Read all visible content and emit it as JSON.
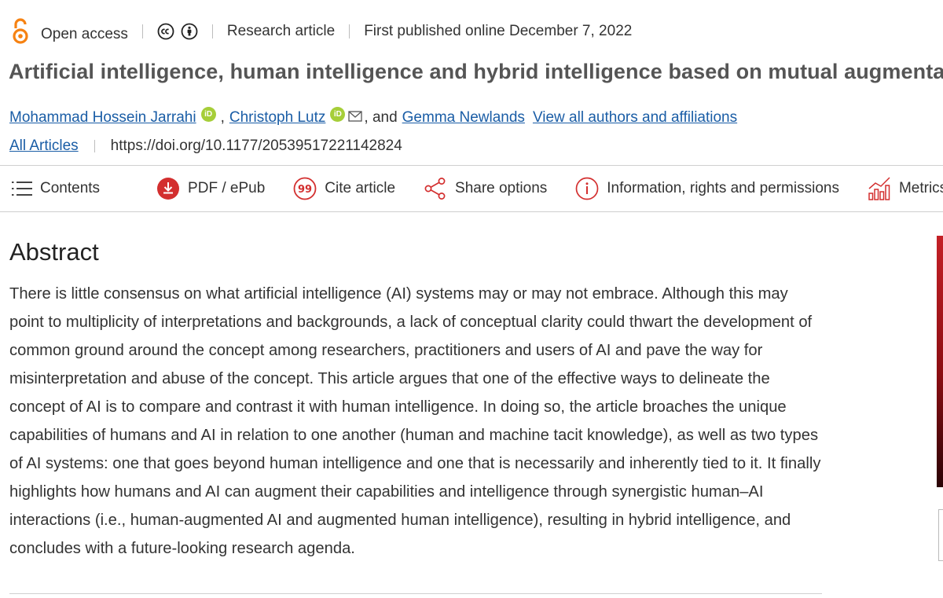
{
  "meta": {
    "open_access_label": "Open access",
    "article_type": "Research article",
    "published": "First published online December 7, 2022",
    "oa_color": "#f68212"
  },
  "title": "Artificial intelligence, human intelligence and hybrid intelligence based on mutual augmentation",
  "authors": {
    "list": [
      {
        "name": "Mohammad Hossein Jarrahi",
        "orcid": true
      },
      {
        "name": "Christoph Lutz",
        "orcid": true,
        "email": true
      },
      {
        "name": "Gemma Newlands",
        "orcid": false
      }
    ],
    "separator": ",",
    "and_text": ", and",
    "view_all": "View all authors and affiliations",
    "orcid_label": "iD"
  },
  "links": {
    "all_articles": "All Articles",
    "doi": "https://doi.org/10.1177/20539517221142824"
  },
  "toolbar": {
    "contents": "Contents",
    "pdf": "PDF / ePub",
    "cite": "Cite article",
    "share": "Share options",
    "info": "Information, rights and permissions",
    "metrics": "Metrics",
    "accent_color": "#d32f2f"
  },
  "abstract": {
    "heading": "Abstract",
    "text": "There is little consensus on what artificial intelligence (AI) systems may or may not embrace. Although this may point to multiplicity of interpretations and backgrounds, a lack of conceptual clarity could thwart the development of common ground around the concept among researchers, practitioners and users of AI and pave the way for misinterpretation and abuse of the concept. This article argues that one of the effective ways to delineate the concept of AI is to compare and contrast it with human intelligence. In doing so, the article broaches the unique capabilities of humans and AI in relation to one another (human and machine tacit knowledge), as well as two types of AI systems: one that goes beyond human intelligence and one that is necessarily and inherently tied to it. It finally highlights how humans and AI can augment their capabilities and intelligence through synergistic human–AI interactions (i.e., human-augmented AI and augmented human intelligence), resulting in hybrid intelligence, and concludes with a future-looking research agenda."
  },
  "link_color": "#1a5da6"
}
